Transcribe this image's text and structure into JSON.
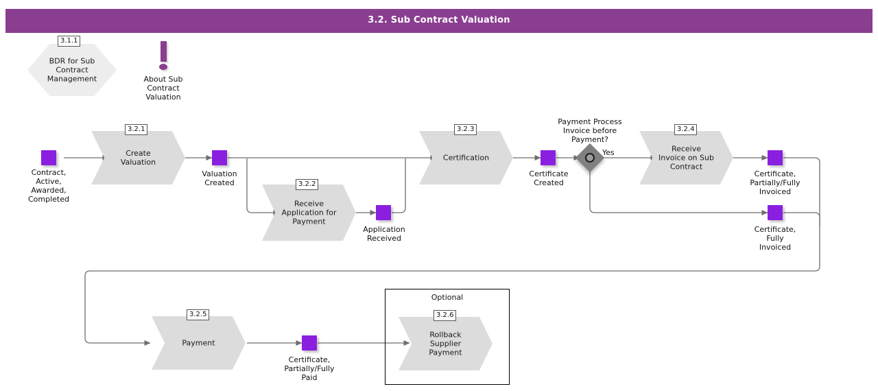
{
  "header": {
    "title": "3.2. Sub Contract Valuation",
    "bar_color": "#8A3E90"
  },
  "colors": {
    "accent_purple": "#8A1FE0",
    "title_purple": "#8A3E90",
    "process_fill": "#DCDCDC",
    "hex_fill": "#EDEDED",
    "decision_fill": "#808080",
    "connector": "#6e6e6e"
  },
  "link_node": {
    "tag": "3.1.1",
    "label": "BDR for Sub\nContract\nManagement"
  },
  "note": {
    "icon": "exclamation-icon",
    "label": "About Sub\nContract\nValuation"
  },
  "states": {
    "start": "Contract,\nActive,\nAwarded,\nCompleted",
    "valuation_created": "Valuation\nCreated",
    "application_received": "Application\nReceived",
    "certificate_created": "Certificate\nCreated",
    "certificate_partially_fully_invoiced": "Certificate,\nPartially/Fully\nInvoiced",
    "certificate_fully_invoiced": "Certificate,\nFully\nInvoiced",
    "certificate_partially_fully_paid": "Certificate,\nPartially/Fully\nPaid"
  },
  "processes": [
    {
      "tag": "3.2.1",
      "label": "Create\nValuation"
    },
    {
      "tag": "3.2.2",
      "label": "Receive\nApplication for\nPayment"
    },
    {
      "tag": "3.2.3",
      "label": "Certification"
    },
    {
      "tag": "3.2.4",
      "label": "Receive\nInvoice on Sub\nContract"
    },
    {
      "tag": "3.2.5",
      "label": "Payment"
    },
    {
      "tag": "3.2.6",
      "label": "Rollback\nSupplier\nPayment"
    }
  ],
  "decision": {
    "question": "Payment Process\nInvoice before\nPayment?",
    "yes_label": "Yes"
  },
  "optional_group": {
    "title": "Optional"
  }
}
